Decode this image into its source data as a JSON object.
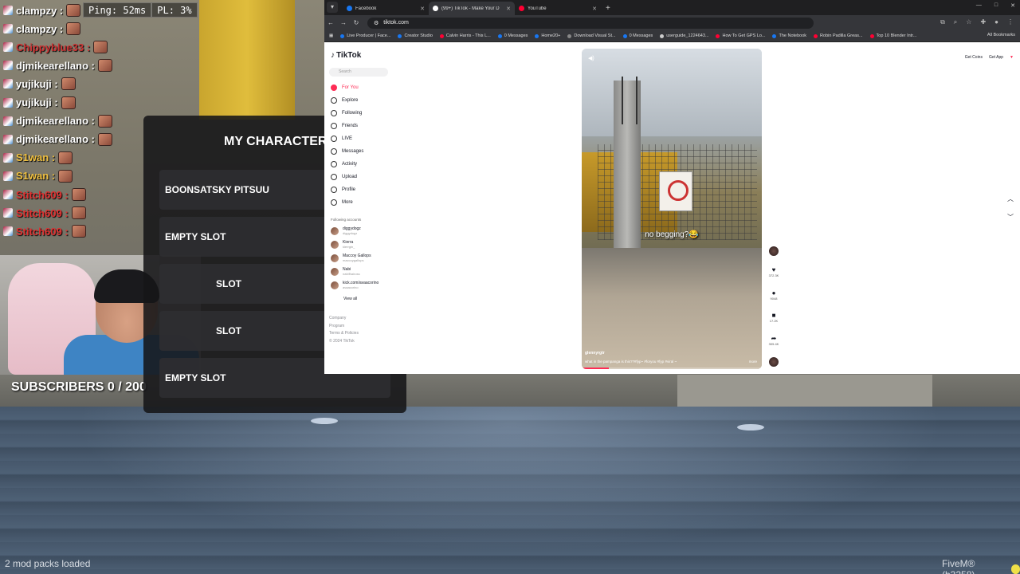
{
  "chat": {
    "stats": {
      "ping": "Ping: 52ms",
      "pl": "PL: 3%"
    },
    "lines": [
      {
        "user": "clampzy :",
        "color": "#ffffff"
      },
      {
        "user": "clampzy :",
        "color": "#ffffff"
      },
      {
        "user": "Chippyblue33 :",
        "color": "#cc3333"
      },
      {
        "user": "djmikearellano :",
        "color": "#ffffff"
      },
      {
        "user": "yujikuji :",
        "color": "#ffffff"
      },
      {
        "user": "yujikuji :",
        "color": "#ffffff"
      },
      {
        "user": "djmikearellano :",
        "color": "#ffffff"
      },
      {
        "user": "djmikearellano :",
        "color": "#ffffff"
      },
      {
        "user": "S1wan :",
        "color": "#f0c040"
      },
      {
        "user": "S1wan :",
        "color": "#f0c040"
      },
      {
        "user": "Stitch609 :",
        "color": "#e03030"
      },
      {
        "user": "Stitch609 :",
        "color": "#e03030"
      },
      {
        "user": "Stitch609 :",
        "color": "#e03030"
      }
    ]
  },
  "overlay": {
    "subscribers": "SUBSCRIBERS 0 / 200"
  },
  "characters": {
    "title": "MY CHARACTERS",
    "slots": [
      "BOONSATSKY PITSUU",
      "EMPTY SLOT",
      "SLOT",
      "SLOT",
      "EMPTY SLOT"
    ]
  },
  "browser": {
    "tabs": [
      {
        "label": "Facebook",
        "color": "#1877f2",
        "active": false
      },
      {
        "label": "(99+) TikTok - Make Your D",
        "color": "#ffffff",
        "active": true
      },
      {
        "label": "YouTube",
        "color": "#ff0033",
        "active": false
      }
    ],
    "url": "tiktok.com",
    "bookmarks": [
      {
        "label": "Live Producer | Face...",
        "color": "#1877f2"
      },
      {
        "label": "Creator Studio",
        "color": "#1877f2"
      },
      {
        "label": "Calvin Harris - This L...",
        "color": "#ff0033"
      },
      {
        "label": "0 Messages",
        "color": "#1877f2"
      },
      {
        "label": "Home20+",
        "color": "#1877f2"
      },
      {
        "label": "Download Visual St...",
        "color": "#888888"
      },
      {
        "label": "0 Messages",
        "color": "#1877f2"
      },
      {
        "label": "userguide_1224643...",
        "color": "#cccccc"
      },
      {
        "label": "How To Get GPS Lo...",
        "color": "#ff0033"
      },
      {
        "label": "The Notebook",
        "color": "#1877f2"
      },
      {
        "label": "Robin Padilla Greas...",
        "color": "#ff0033"
      },
      {
        "label": "Top 10 Blender Intr...",
        "color": "#ff0033"
      }
    ],
    "all_bookmarks": "All Bookmarks"
  },
  "tiktok": {
    "logo": "TikTok",
    "search_placeholder": "Search",
    "nav": [
      {
        "label": "For You",
        "active": true
      },
      {
        "label": "Explore",
        "active": false
      },
      {
        "label": "Following",
        "active": false
      },
      {
        "label": "Friends",
        "active": false
      },
      {
        "label": "LIVE",
        "active": false
      },
      {
        "label": "Messages",
        "active": false
      },
      {
        "label": "Activity",
        "active": false
      },
      {
        "label": "Upload",
        "active": false
      },
      {
        "label": "Profile",
        "active": false
      },
      {
        "label": "More",
        "active": false
      }
    ],
    "following_header": "Following accounts",
    "accounts": [
      {
        "name": "diggydogz",
        "handle": "diggydogz"
      },
      {
        "name": "Kierra",
        "handle": "kierrgin_"
      },
      {
        "name": "Maccoy Gallops",
        "handle": "maccoygallops"
      },
      {
        "name": "Nabi",
        "handle": "nabifhaiross"
      },
      {
        "name": "kick.com/avaacorino",
        "handle": "avaacorino"
      }
    ],
    "view_all": "View all",
    "footer": [
      "Company",
      "Program",
      "Terms & Policies",
      "© 2024 TikTok"
    ],
    "top_right": {
      "get_coins": "Get Coins",
      "get_app": "Get App"
    },
    "video": {
      "caption": "no begging?😂",
      "user": "glennyrgtr",
      "description": "what in the pampanga is this??#fyp~ #foryou #fyp #viral ~",
      "more": "more",
      "progress": 0.15
    },
    "actions": [
      {
        "icon": "heart-icon",
        "glyph": "♥",
        "count": "372.3K"
      },
      {
        "icon": "comment-icon",
        "glyph": "●",
        "count": "9048"
      },
      {
        "icon": "bookmark-icon",
        "glyph": "■",
        "count": "17.2K"
      },
      {
        "icon": "share-icon",
        "glyph": "➦",
        "count": "305.4K"
      }
    ]
  },
  "status": {
    "mods": "2 mod packs loaded",
    "fivem": "FiveM® (b3258)"
  }
}
